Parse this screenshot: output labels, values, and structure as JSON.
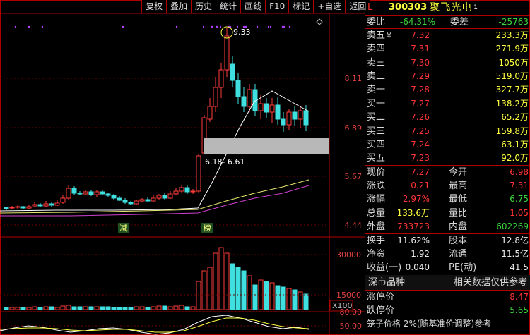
{
  "toolbar": [
    "复权",
    "叠加",
    "历史",
    "统计",
    "画线",
    "F10",
    "标记",
    "+自选",
    "返回"
  ],
  "chart": {
    "price_labels": [
      "8.11",
      "6.89",
      "5.67",
      "4.44"
    ],
    "high_annotation": "9.33",
    "range_annotation": "6.18- 6.61",
    "event_tags": [
      "减",
      "榜"
    ],
    "volume_labels": [
      "30000",
      "15000"
    ],
    "volume_unit": "X100",
    "indicator_labels": [
      "80.00",
      "50.00"
    ]
  },
  "chart_data": {
    "type": "candlestick",
    "price_axis": [
      4.44,
      5.67,
      6.89,
      8.11
    ],
    "high_marker": 9.33,
    "band": [
      6.18,
      6.61
    ],
    "volume_axis": [
      15000,
      30000
    ],
    "volume_unit": "X100",
    "indicator_axis": [
      50.0,
      80.0
    ]
  },
  "quote": {
    "flag": "L",
    "code": "300303",
    "name": "聚飞光电",
    "name_mark": "1",
    "weibi": {
      "label": "委比",
      "value": "-64.31%",
      "label2": "委差",
      "value2": "-25763"
    },
    "asks": [
      {
        "label": "卖五",
        "suffix": "¥",
        "price": "7.32",
        "vol": "233.3万"
      },
      {
        "label": "卖四",
        "suffix": "",
        "price": "7.31",
        "vol": "271.9万"
      },
      {
        "label": "卖三",
        "suffix": "",
        "price": "7.30",
        "vol": "1050万"
      },
      {
        "label": "卖二",
        "suffix": "",
        "price": "7.29",
        "vol": "519.0万"
      },
      {
        "label": "卖一",
        "suffix": "",
        "price": "7.28",
        "vol": "327.7万"
      }
    ],
    "bids": [
      {
        "label": "买一",
        "price": "7.27",
        "vol": "138.2万"
      },
      {
        "label": "买二",
        "price": "7.26",
        "vol": "65.2万"
      },
      {
        "label": "买三",
        "price": "7.25",
        "vol": "159.8万"
      },
      {
        "label": "买四",
        "price": "7.24",
        "vol": "63.1万"
      },
      {
        "label": "买五",
        "price": "7.23",
        "vol": "92.0万"
      }
    ],
    "stats1": [
      {
        "l1": "现价",
        "v1": "7.27",
        "c1": "red",
        "l2": "今开",
        "v2": "6.98",
        "c2": "red"
      },
      {
        "l1": "涨跌",
        "v1": "0.21",
        "c1": "red",
        "l2": "最高",
        "v2": "7.31",
        "c2": "red"
      },
      {
        "l1": "涨幅",
        "v1": "2.97%",
        "c1": "red",
        "l2": "最低",
        "v2": "6.75",
        "c2": "green"
      },
      {
        "l1": "总量",
        "v1": "133.6万",
        "c1": "yellow",
        "l2": "量比",
        "v2": "1.05",
        "c2": "red"
      },
      {
        "l1": "外盘",
        "v1": "733723",
        "c1": "red",
        "l2": "内盘",
        "v2": "602269",
        "c2": "green"
      }
    ],
    "stats2": [
      {
        "l1": "换手",
        "v1": "11.62%",
        "c1": "white",
        "l2": "股本",
        "v2": "12.8亿",
        "c2": "white"
      },
      {
        "l1": "净资",
        "v1": "1.92",
        "c1": "white",
        "l2": "流通",
        "v2": "11.5亿",
        "c2": "white"
      },
      {
        "l1": "收益(一)",
        "v1": "0.040",
        "c1": "white",
        "l2": "PE(动)",
        "v2": "41.5",
        "c2": "white"
      }
    ],
    "info_bar": {
      "left": "深市品种",
      "right": "相关数据仅供参考"
    },
    "limits": [
      {
        "label": "涨停价",
        "value": "8.47",
        "color": "red"
      },
      {
        "label": "跌停价",
        "value": "5.65",
        "color": "green"
      }
    ],
    "footer_text": "笼子价格 2%(随基准价调整)参考"
  }
}
